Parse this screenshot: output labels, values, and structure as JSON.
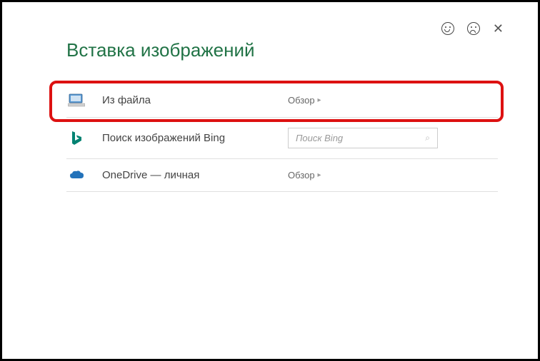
{
  "dialog": {
    "title": "Вставка изображений"
  },
  "options": {
    "file": {
      "label": "Из файла",
      "action": "Обзор"
    },
    "bing": {
      "label": "Поиск изображений Bing",
      "placeholder": "Поиск Bing"
    },
    "onedrive": {
      "label": "OneDrive — личная",
      "action": "Обзор"
    }
  },
  "icons": {
    "chevron": "▸",
    "search": "⌕",
    "close": "✕"
  }
}
